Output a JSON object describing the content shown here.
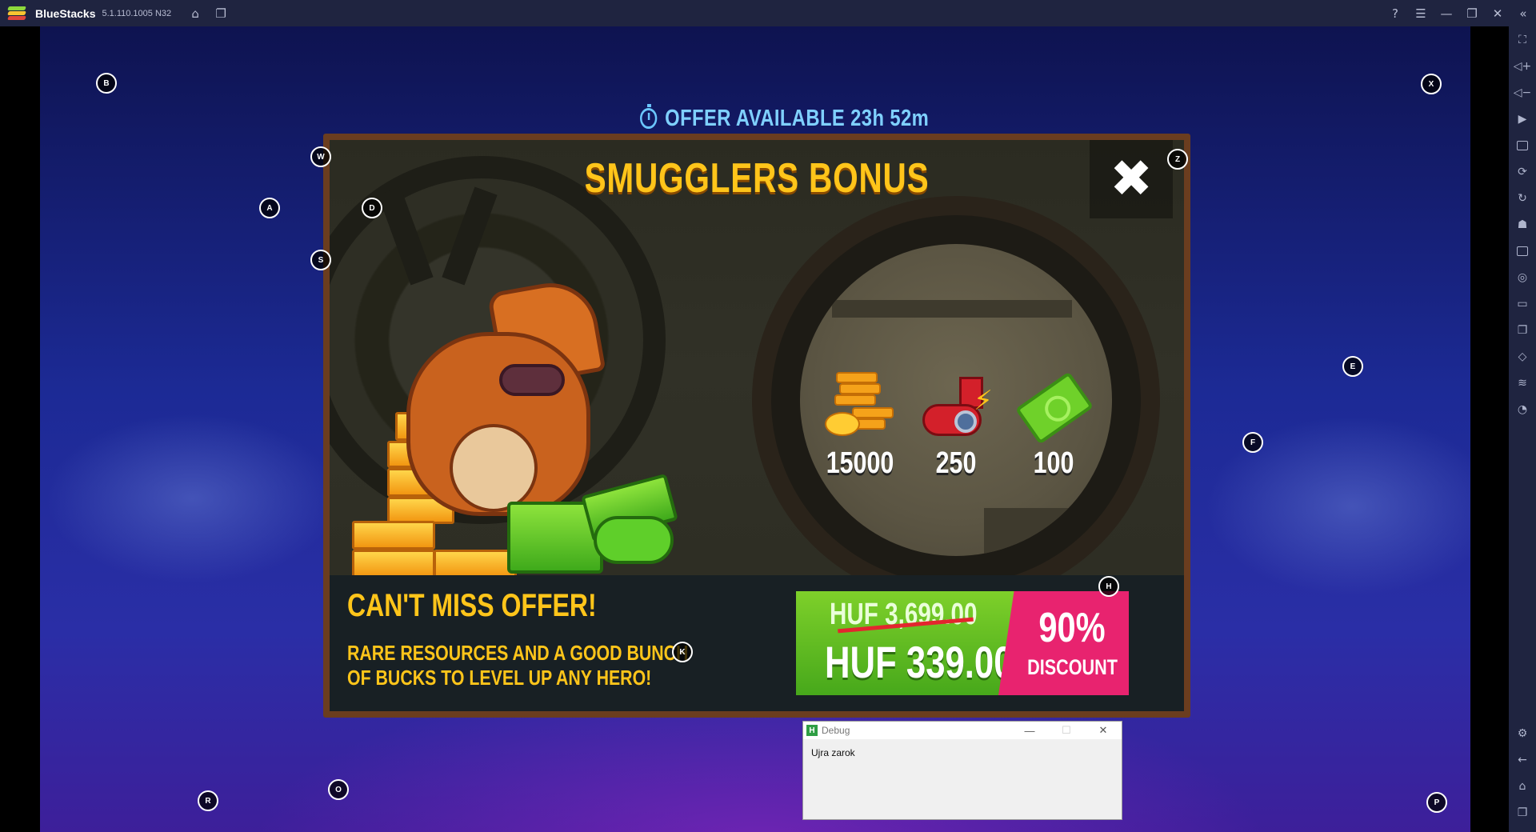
{
  "titlebar": {
    "app_name": "BlueStacks",
    "app_version": "5.1.110.1005 N32",
    "icons_left": [
      "home-icon",
      "multi-instance-icon"
    ],
    "icons_right": [
      "help-icon",
      "menu-icon",
      "minimize-icon",
      "restore-icon",
      "close-icon",
      "collapse-sidebar-icon"
    ]
  },
  "sidebar": {
    "tools_top": [
      "fullscreen-icon",
      "volume-up-icon",
      "volume-down-icon",
      "media-icon",
      "keyboard-icon",
      "macro-icon",
      "sync-icon",
      "controls-icon",
      "apk-icon",
      "screenshot-icon",
      "folder-icon",
      "multi-instance-icon",
      "eco-mode-icon",
      "layers-icon",
      "rotate-icon"
    ],
    "tools_bottom": [
      "settings-icon",
      "back-icon",
      "home-icon",
      "recent-apps-icon"
    ]
  },
  "game": {
    "offer_timer": "OFFER AVAILABLE 23h 52m",
    "key_markers": [
      "B",
      "X",
      "W",
      "Z",
      "A",
      "D",
      "S",
      "E",
      "F",
      "H",
      "K",
      "R",
      "O",
      "P"
    ],
    "popup": {
      "title": "SMUGGLERS BONUS",
      "close_symbol": "✖",
      "rewards": [
        {
          "type": "coins",
          "value": "15000"
        },
        {
          "type": "gadget",
          "value": "250"
        },
        {
          "type": "cash",
          "value": "100"
        }
      ],
      "headline": "CAN'T MISS OFFER!",
      "description": "RARE RESOURCES AND A GOOD BUNCH OF BUCKS TO LEVEL UP ANY HERO!",
      "old_price": "HUF 3,699.00",
      "new_price": "HUF 339.00",
      "discount_percent": "90%",
      "discount_label": "DISCOUNT"
    }
  },
  "debug": {
    "title": "Debug",
    "message": "Ujra zarok",
    "controls": [
      "minimize",
      "maximize",
      "close"
    ]
  },
  "colors": {
    "titlebar_bg": "#1f2440",
    "title_gold": "#ffc51a",
    "timer_blue": "#7fd0ff",
    "buy_green": "#5fbf23",
    "discount_pink": "#e8236f"
  }
}
